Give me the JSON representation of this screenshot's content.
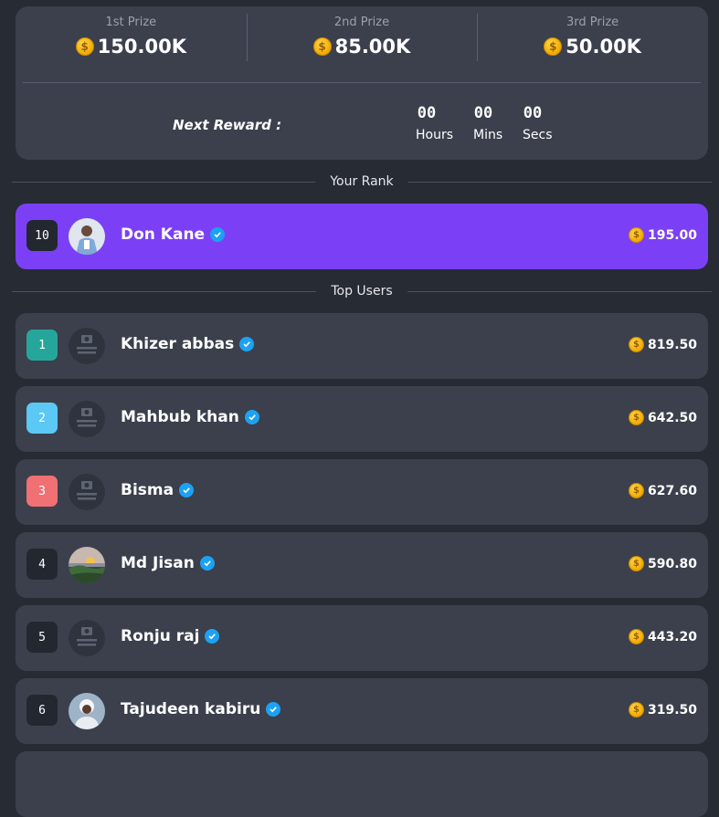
{
  "prizes": [
    {
      "label": "1st Prize",
      "amount": "150.00K"
    },
    {
      "label": "2nd Prize",
      "amount": "85.00K"
    },
    {
      "label": "3rd Prize",
      "amount": "50.00K"
    }
  ],
  "next_reward": {
    "label": "Next Reward :",
    "hours": "00",
    "hours_label": "Hours",
    "mins": "00",
    "mins_label": "Mins",
    "secs": "00",
    "secs_label": "Secs"
  },
  "your_rank": {
    "title": "Your Rank",
    "rank": "10",
    "name": "Don Kane",
    "score": "195.00"
  },
  "top_users": {
    "title": "Top Users",
    "users": [
      {
        "rank": "1",
        "name": "Khizer abbas",
        "score": "819.50"
      },
      {
        "rank": "2",
        "name": "Mahbub khan",
        "score": "642.50"
      },
      {
        "rank": "3",
        "name": "Bisma",
        "score": "627.60"
      },
      {
        "rank": "4",
        "name": "Md Jisan",
        "score": "590.80"
      },
      {
        "rank": "5",
        "name": "Ronju raj",
        "score": "443.20"
      },
      {
        "rank": "6",
        "name": "Tajudeen kabiru",
        "score": "319.50"
      }
    ]
  },
  "colors": {
    "background": "#272b34",
    "card": "#3b404c",
    "highlight": "#7b40f5",
    "rank1": "#26a69a",
    "rank2": "#5bc8f5",
    "rank3": "#f07074",
    "verified": "#1da1f2",
    "coin": "#f2a900"
  },
  "icons": {
    "coin": "coin-icon",
    "verified": "verified-badge-icon",
    "no_image": "no-image-placeholder-icon"
  },
  "placeholder_text": "NO IMAGE AVAILABLE"
}
